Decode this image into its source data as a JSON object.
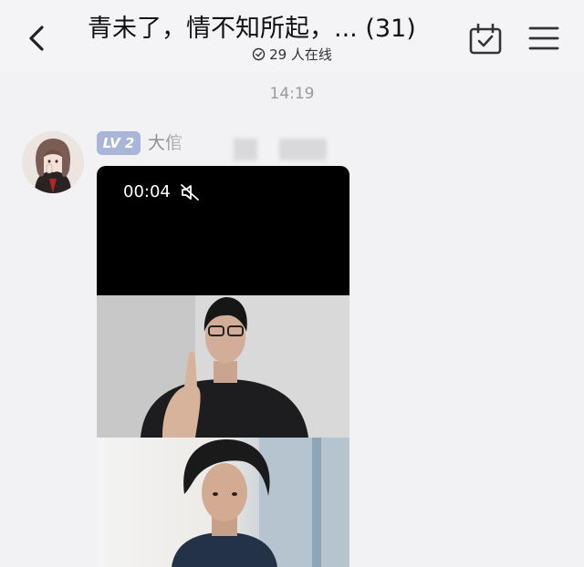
{
  "header": {
    "title": "青未了，情不知所起，... (31)",
    "online_text": "29 人在线"
  },
  "chat": {
    "timestamp": "14:19",
    "message": {
      "level_badge": "LV 2",
      "sender_name_visible": "大倌",
      "video": {
        "duration": "00:04",
        "muted": true
      }
    }
  },
  "colors": {
    "background": "#f2f2f4",
    "badge": "#a9b6d8",
    "timestamp_text": "#9a9a9a"
  },
  "icons": [
    "back-arrow-icon",
    "online-clock-icon",
    "calendar-check-icon",
    "menu-icon",
    "mute-icon"
  ]
}
